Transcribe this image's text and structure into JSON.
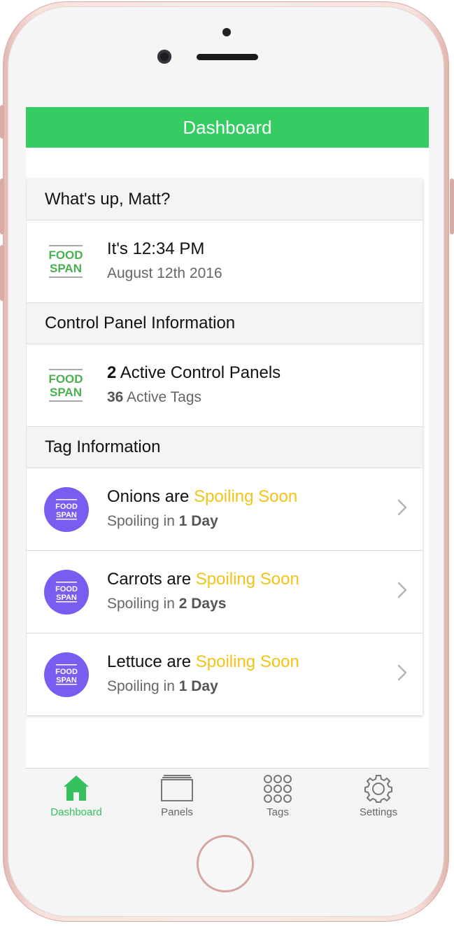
{
  "nav": {
    "title": "Dashboard"
  },
  "greeting_section": {
    "header": "What's up, Matt?",
    "time_title": "It's 12:34 PM",
    "date": "August 12th 2016",
    "logo_text": [
      "FOOD",
      "SPAN"
    ]
  },
  "control_section": {
    "header": "Control Panel Information",
    "panels_count": "2",
    "panels_label": " Active Control Panels",
    "tags_count": "36",
    "tags_label": " Active Tags"
  },
  "tag_section": {
    "header": "Tag Information",
    "items": [
      {
        "name": "Onions are ",
        "status": "Spoiling Soon",
        "sub_prefix": "Spoiling in ",
        "sub_value": "1 Day"
      },
      {
        "name": "Carrots are ",
        "status": "Spoiling Soon",
        "sub_prefix": "Spoiling in ",
        "sub_value": "2 Days"
      },
      {
        "name": "Lettuce are ",
        "status": "Spoiling Soon",
        "sub_prefix": "Spoiling in ",
        "sub_value": "1 Day"
      }
    ]
  },
  "tab_bar": {
    "tabs": [
      {
        "label": "Dashboard",
        "icon": "home-icon",
        "active": true
      },
      {
        "label": "Panels",
        "icon": "panels-icon",
        "active": false
      },
      {
        "label": "Tags",
        "icon": "grid-icon",
        "active": false
      },
      {
        "label": "Settings",
        "icon": "gear-icon",
        "active": false
      }
    ]
  },
  "colors": {
    "brand_green": "#35cd63",
    "status_yellow": "#f2c418",
    "tag_purple": "#7b5cf0",
    "logo_green": "#4caf50"
  }
}
